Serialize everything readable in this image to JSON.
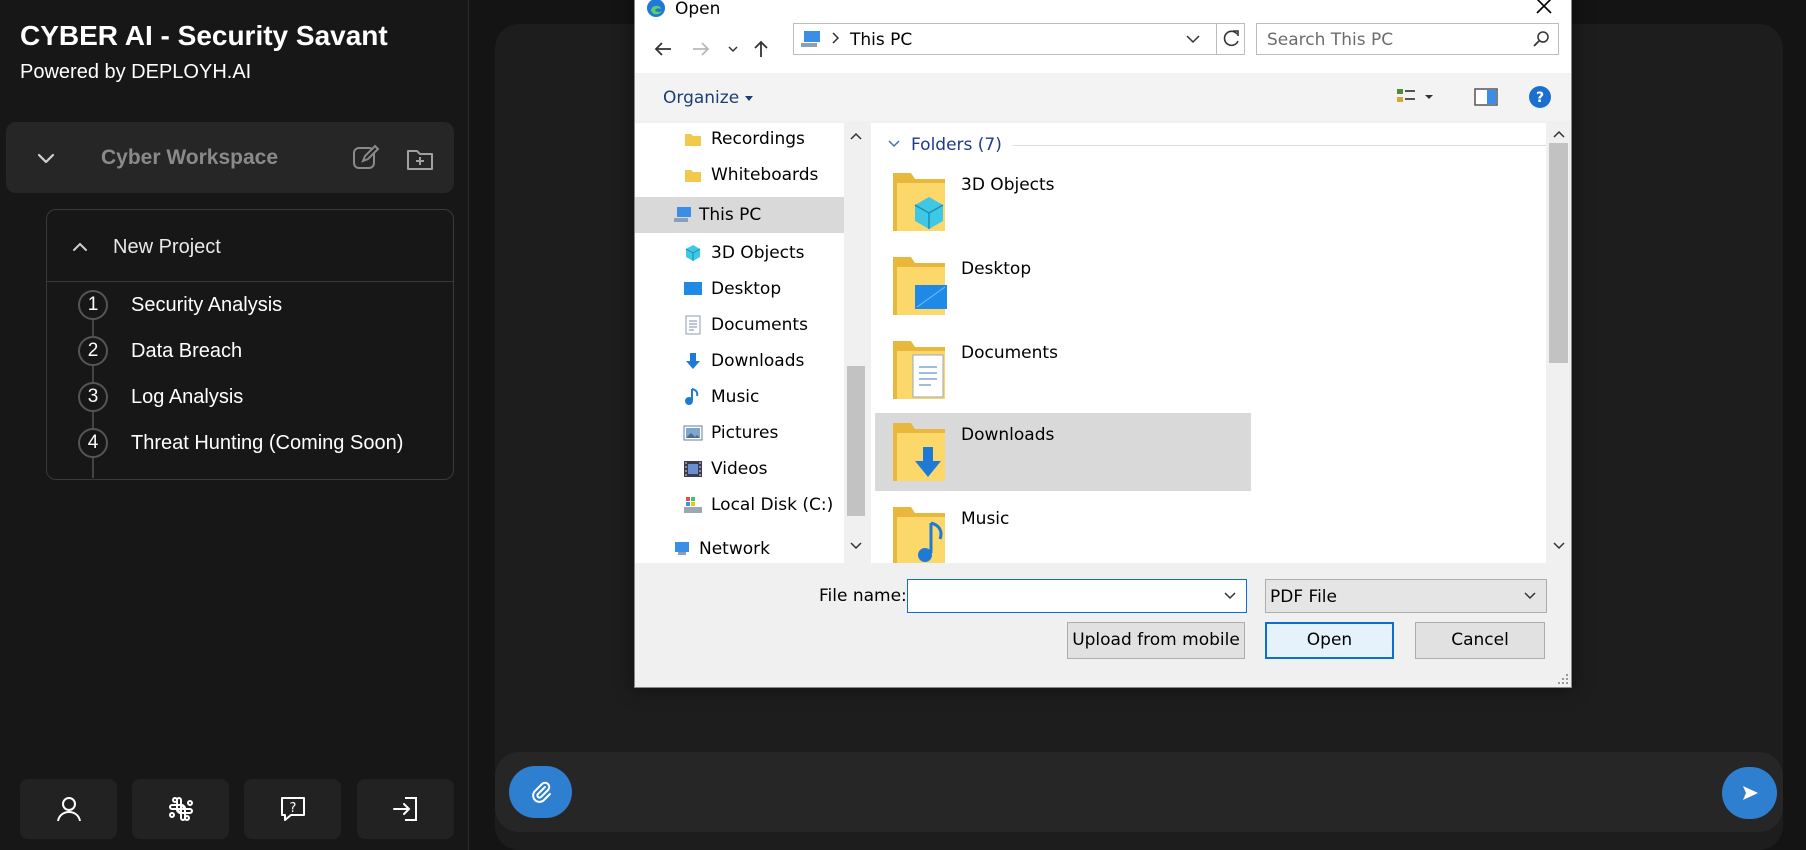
{
  "app": {
    "title": "CYBER AI - Security Savant",
    "subtitle": "Powered by DEPLOYH.AI"
  },
  "workspace": {
    "label": "Cyber Workspace"
  },
  "project": {
    "title": "New Project",
    "steps": [
      {
        "num": "1",
        "label": "Security Analysis"
      },
      {
        "num": "2",
        "label": "Data Breach"
      },
      {
        "num": "3",
        "label": "Log Analysis"
      },
      {
        "num": "4",
        "label": "Threat Hunting (Coming Soon)"
      }
    ]
  },
  "bottom_icons": [
    "user-icon",
    "slack-icon",
    "help-icon",
    "logout-icon"
  ],
  "dialog": {
    "title": "Open",
    "address": "This PC",
    "search_placeholder": "Search This PC",
    "organize": "Organize",
    "nav_items": [
      {
        "label": "Recordings",
        "icon": "folder-icon"
      },
      {
        "label": "Whiteboards",
        "icon": "folder-icon"
      },
      {
        "label": "This PC",
        "icon": "computer-icon",
        "selected": true
      },
      {
        "label": "3D Objects",
        "icon": "cube-icon"
      },
      {
        "label": "Desktop",
        "icon": "desktop-icon"
      },
      {
        "label": "Documents",
        "icon": "documents-icon"
      },
      {
        "label": "Downloads",
        "icon": "download-icon"
      },
      {
        "label": "Music",
        "icon": "music-icon"
      },
      {
        "label": "Pictures",
        "icon": "pictures-icon"
      },
      {
        "label": "Videos",
        "icon": "videos-icon"
      },
      {
        "label": "Local Disk (C:)",
        "icon": "drive-icon"
      },
      {
        "label": "Network",
        "icon": "network-icon"
      }
    ],
    "group_label": "Folders (7)",
    "folders": [
      {
        "label": "3D Objects",
        "overlay": "cube"
      },
      {
        "label": "Desktop",
        "overlay": "desktop"
      },
      {
        "label": "Documents",
        "overlay": "document"
      },
      {
        "label": "Downloads",
        "overlay": "download",
        "selected": true
      },
      {
        "label": "Music",
        "overlay": "music"
      }
    ],
    "file_name_label": "File name:",
    "file_name_value": "",
    "file_type": "PDF File",
    "buttons": {
      "upload": "Upload from mobile",
      "open": "Open",
      "cancel": "Cancel"
    }
  },
  "colors": {
    "accent": "#2f7fd0",
    "sidebar_bg": "#171717",
    "panel_bg": "#1d1d1d"
  }
}
